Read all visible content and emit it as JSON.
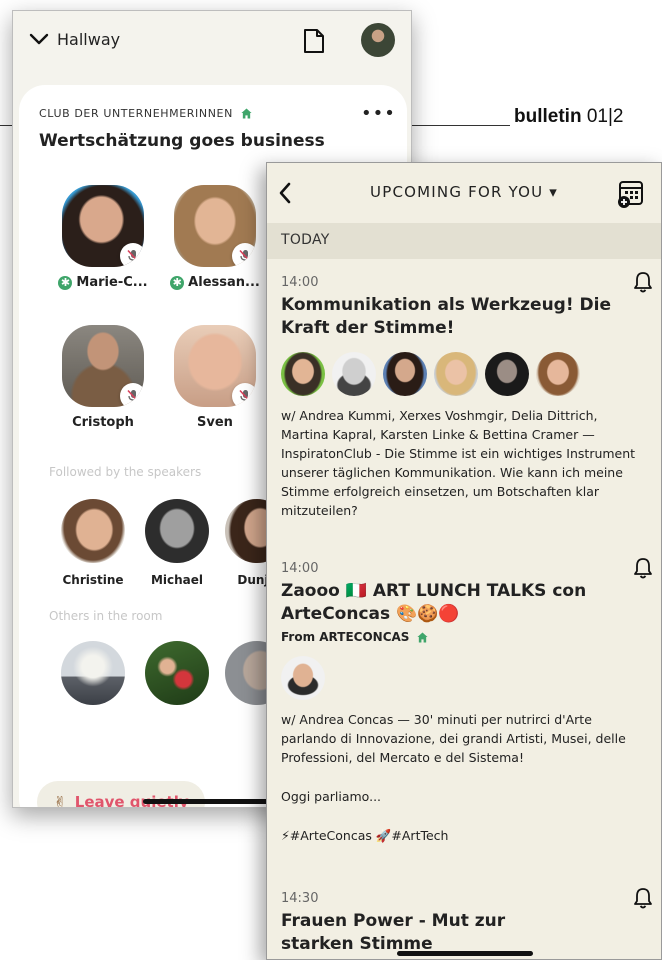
{
  "magazine": {
    "bulletin": "bulletin",
    "issue": "01|2"
  },
  "hallway": {
    "back_label": "Hallway",
    "club_name": "CLUB DER UNTERNEHMERINNEN",
    "room_title": "Wertschätzung goes business",
    "more": "•••",
    "speakers": [
      {
        "name": "Marie-C...",
        "moderator": true
      },
      {
        "name": "Alessan...",
        "moderator": true
      },
      {
        "name": "Cristoph",
        "moderator": false
      },
      {
        "name": "Sven",
        "moderator": false
      }
    ],
    "moderator_mark": "✱",
    "followed_label": "Followed by the speakers",
    "followed": [
      "Christine",
      "Michael",
      "Dunja"
    ],
    "others_label": "Others in the room",
    "leave_emoji": "✌",
    "leave_label": "Leave quietly"
  },
  "upcoming": {
    "title": "UPCOMING FOR YOU ▾",
    "section": "TODAY",
    "events": [
      {
        "time": "14:00",
        "title": "Kommunikation als Werkzeug! Die Kraft der Stimme!",
        "description": "w/ Andrea Kummi, Xerxes Voshmgir, Delia Dittrich, Martina Kapral, Karsten Linke & Bettina Cramer — InspiratonClub - Die Stimme ist ein wichtiges Instrument unserer täglichen Kommunikation. Wie kann ich meine Stimme erfolgreich einsetzen, um Botschaften klar mitzuteilen?"
      },
      {
        "time": "14:00",
        "title": "Zaooo 🇮🇹 ART LUNCH TALKS con ArteConcas 🎨🍪🔴",
        "from": "From ARTECONCAS",
        "description": "w/ Andrea Concas — 30' minuti per nutrirci d'Arte parlando di Innovazione, dei grandi Artisti, Musei, delle Professioni, del Mercato e del Sistema!",
        "extra": "Oggi parliamo...",
        "tags": "⚡#ArteConcas 🚀#ArtTech"
      },
      {
        "time": "14:30",
        "title": "Frauen Power - Mut zur starken Stimme"
      }
    ]
  },
  "colors": {
    "leave_red": "#e0556c",
    "club_green": "#3fa56a",
    "beige": "#f2efe3"
  }
}
